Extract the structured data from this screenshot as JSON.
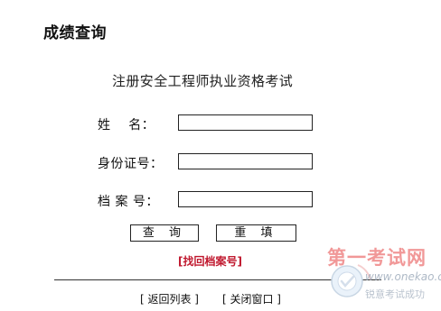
{
  "page": {
    "title": "成绩查询",
    "exam_name": "注册安全工程师执业资格考试"
  },
  "form": {
    "name_label": "姓    名：",
    "name_value": "",
    "id_label": "身份证号：",
    "id_value": "",
    "file_label": "档 案 号：",
    "file_value": ""
  },
  "buttons": {
    "query_label": "查 询",
    "reset_label": "重 填"
  },
  "links": {
    "retrieve_file": "[找回档案号]",
    "back_to_list": "[ 返回列表 ]",
    "close_window": "[ 关闭窗口 ]"
  },
  "watermark": {
    "brand": "第一考试网",
    "url": "www.onekao.com",
    "slogan": "锐意考试成功"
  },
  "colors": {
    "accent_link": "#c0182e",
    "watermark_red": "#e64545"
  }
}
